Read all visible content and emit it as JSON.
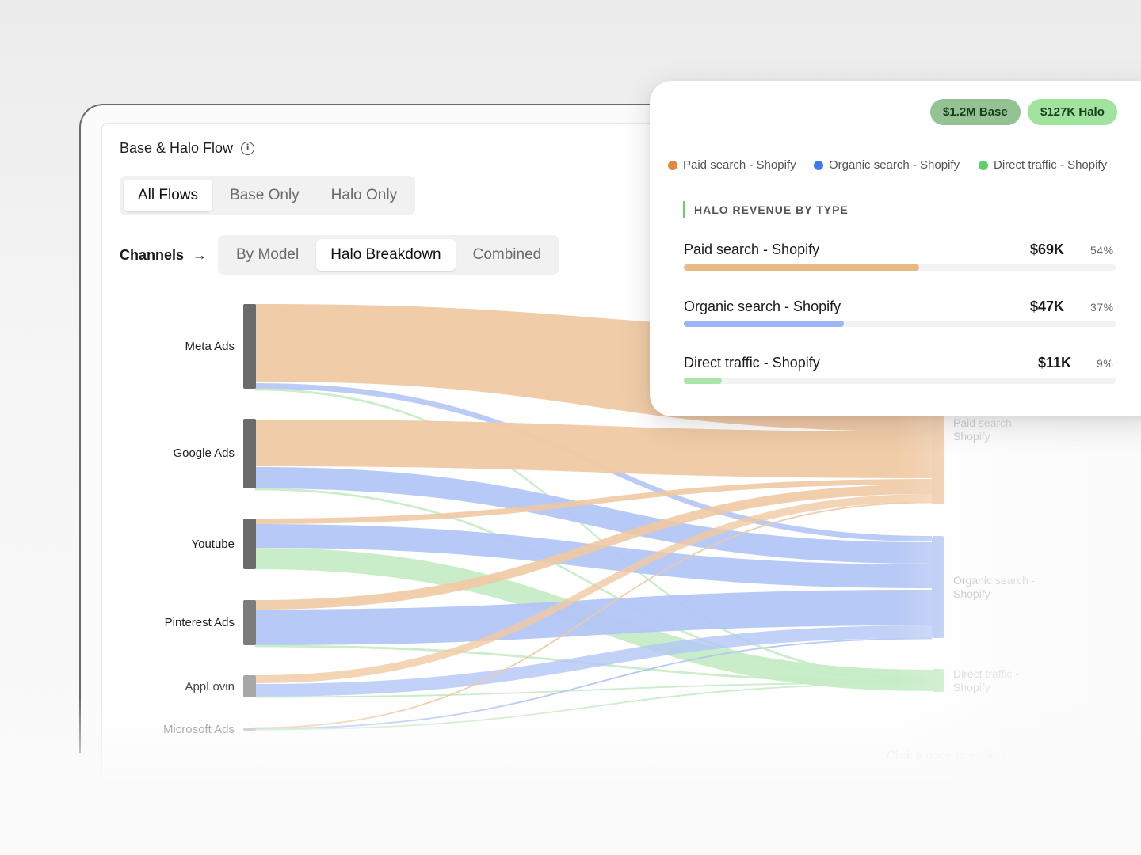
{
  "card": {
    "title": "Base & Halo Flow",
    "info_icon": "info-icon"
  },
  "flow_tabs": [
    {
      "label": "All Flows",
      "active": true
    },
    {
      "label": "Base Only",
      "active": false
    },
    {
      "label": "Halo Only",
      "active": false
    }
  ],
  "channels": {
    "label": "Channels",
    "arrow": "→",
    "tabs": [
      {
        "label": "By Model",
        "active": false
      },
      {
        "label": "Halo Breakdown",
        "active": true
      },
      {
        "label": "Combined",
        "active": false
      }
    ]
  },
  "sankey": {
    "sources": [
      "Meta Ads",
      "Google Ads",
      "Youtube",
      "Pinterest Ads",
      "AppLovin",
      "Microsoft Ads"
    ],
    "targets": [
      "Paid search - Shopify",
      "Organic search - Shopify",
      "Direct traffic - Shopify"
    ],
    "target_colors": {
      "Paid search - Shopify": "#f0c9a3",
      "Organic search - Shopify": "#b3c6f5",
      "Direct traffic - Shopify": "#c6ecc6"
    },
    "hint": "Click a node to explore"
  },
  "popup": {
    "base_pill": "$1.2M Base",
    "halo_pill": "$127K Halo",
    "legend": [
      {
        "label": "Paid search - Shopify",
        "color": "#e08a3c"
      },
      {
        "label": "Organic search - Shopify",
        "color": "#3f78ea"
      },
      {
        "label": "Direct traffic - Shopify",
        "color": "#5fcf6a"
      }
    ],
    "section_title": "HALO REVENUE BY TYPE",
    "rows": [
      {
        "label": "Paid search - Shopify",
        "value": "$69K",
        "pct": "54%",
        "fraction": 0.545,
        "color": "#e9b887"
      },
      {
        "label": "Organic search - Shopify",
        "value": "$47K",
        "pct": "37%",
        "fraction": 0.37,
        "color": "#9bb5f6"
      },
      {
        "label": "Direct traffic - Shopify",
        "value": "$11K",
        "pct": "9%",
        "fraction": 0.088,
        "color": "#a8e5ac"
      }
    ]
  }
}
